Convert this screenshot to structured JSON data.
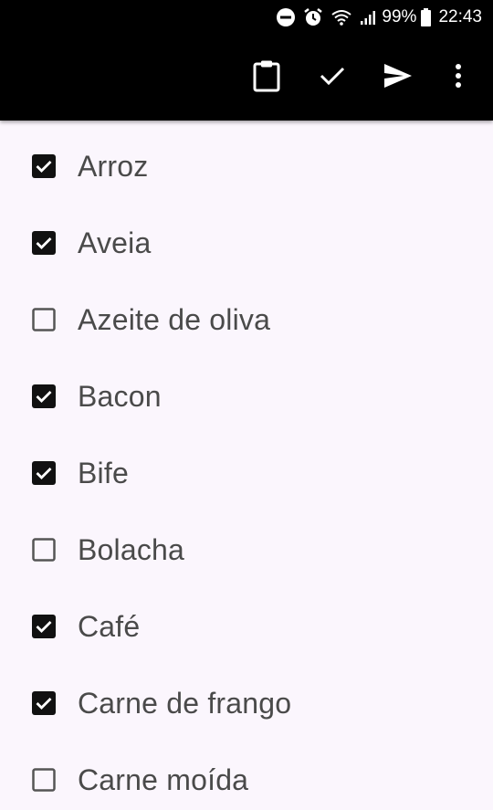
{
  "status_bar": {
    "battery_percent": "99%",
    "time": "22:43"
  },
  "toolbar": {
    "actions": [
      "clipboard-icon",
      "check-icon",
      "send-icon",
      "more-vert-icon"
    ]
  },
  "colors": {
    "bar_background": "#000000",
    "list_background": "#fbf6fd",
    "text": "#4a4a4a",
    "checkbox": "#111111"
  },
  "list": {
    "items": [
      {
        "label": "Arroz",
        "checked": true
      },
      {
        "label": "Aveia",
        "checked": true
      },
      {
        "label": "Azeite de oliva",
        "checked": false
      },
      {
        "label": "Bacon",
        "checked": true
      },
      {
        "label": "Bife",
        "checked": true
      },
      {
        "label": "Bolacha",
        "checked": false
      },
      {
        "label": "Café",
        "checked": true
      },
      {
        "label": "Carne de frango",
        "checked": true
      },
      {
        "label": "Carne moída",
        "checked": false
      }
    ]
  }
}
